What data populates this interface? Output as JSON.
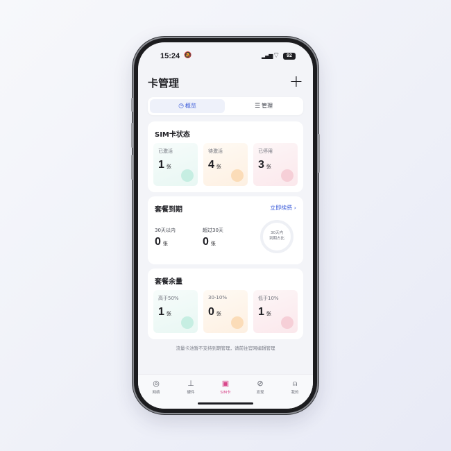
{
  "status_bar": {
    "time": "15:24",
    "battery": "92"
  },
  "header": {
    "title": "卡管理",
    "add_label": "+"
  },
  "segments": [
    {
      "label": "概览",
      "icon": "clock-icon"
    },
    {
      "label": "管理",
      "icon": "list-icon"
    }
  ],
  "sim_status": {
    "title": "SIM卡状态",
    "tiles": [
      {
        "label": "已激活",
        "value": "1",
        "unit": "张"
      },
      {
        "label": "待激活",
        "value": "4",
        "unit": "张"
      },
      {
        "label": "已停用",
        "value": "3",
        "unit": "张"
      }
    ]
  },
  "plan_expiry": {
    "title": "套餐到期",
    "renew_label": "立即续费 ›",
    "stats": [
      {
        "label": "30天以内",
        "value": "0",
        "unit": "张"
      },
      {
        "label": "超过30天",
        "value": "0",
        "unit": "张"
      }
    ],
    "ring_line1": "30天内",
    "ring_line2": "到期占比"
  },
  "plan_remaining": {
    "title": "套餐余量",
    "tiles": [
      {
        "label": "高于50%",
        "value": "1",
        "unit": "张"
      },
      {
        "label": "30-10%",
        "value": "0",
        "unit": "张"
      },
      {
        "label": "低于10%",
        "value": "1",
        "unit": "张"
      }
    ]
  },
  "footer_note": "流量卡池暂不支持到期管理，请前往官网编辑管理",
  "tabbar": [
    {
      "label": "网络",
      "icon": "network-icon"
    },
    {
      "label": "硬件",
      "icon": "router-icon"
    },
    {
      "label": "SIM卡",
      "icon": "sim-card-icon",
      "active": true
    },
    {
      "label": "发现",
      "icon": "compass-icon"
    },
    {
      "label": "我的",
      "icon": "user-icon"
    }
  ],
  "colors": {
    "accent": "#3b5bd9",
    "active_tab": "#d8468a"
  }
}
